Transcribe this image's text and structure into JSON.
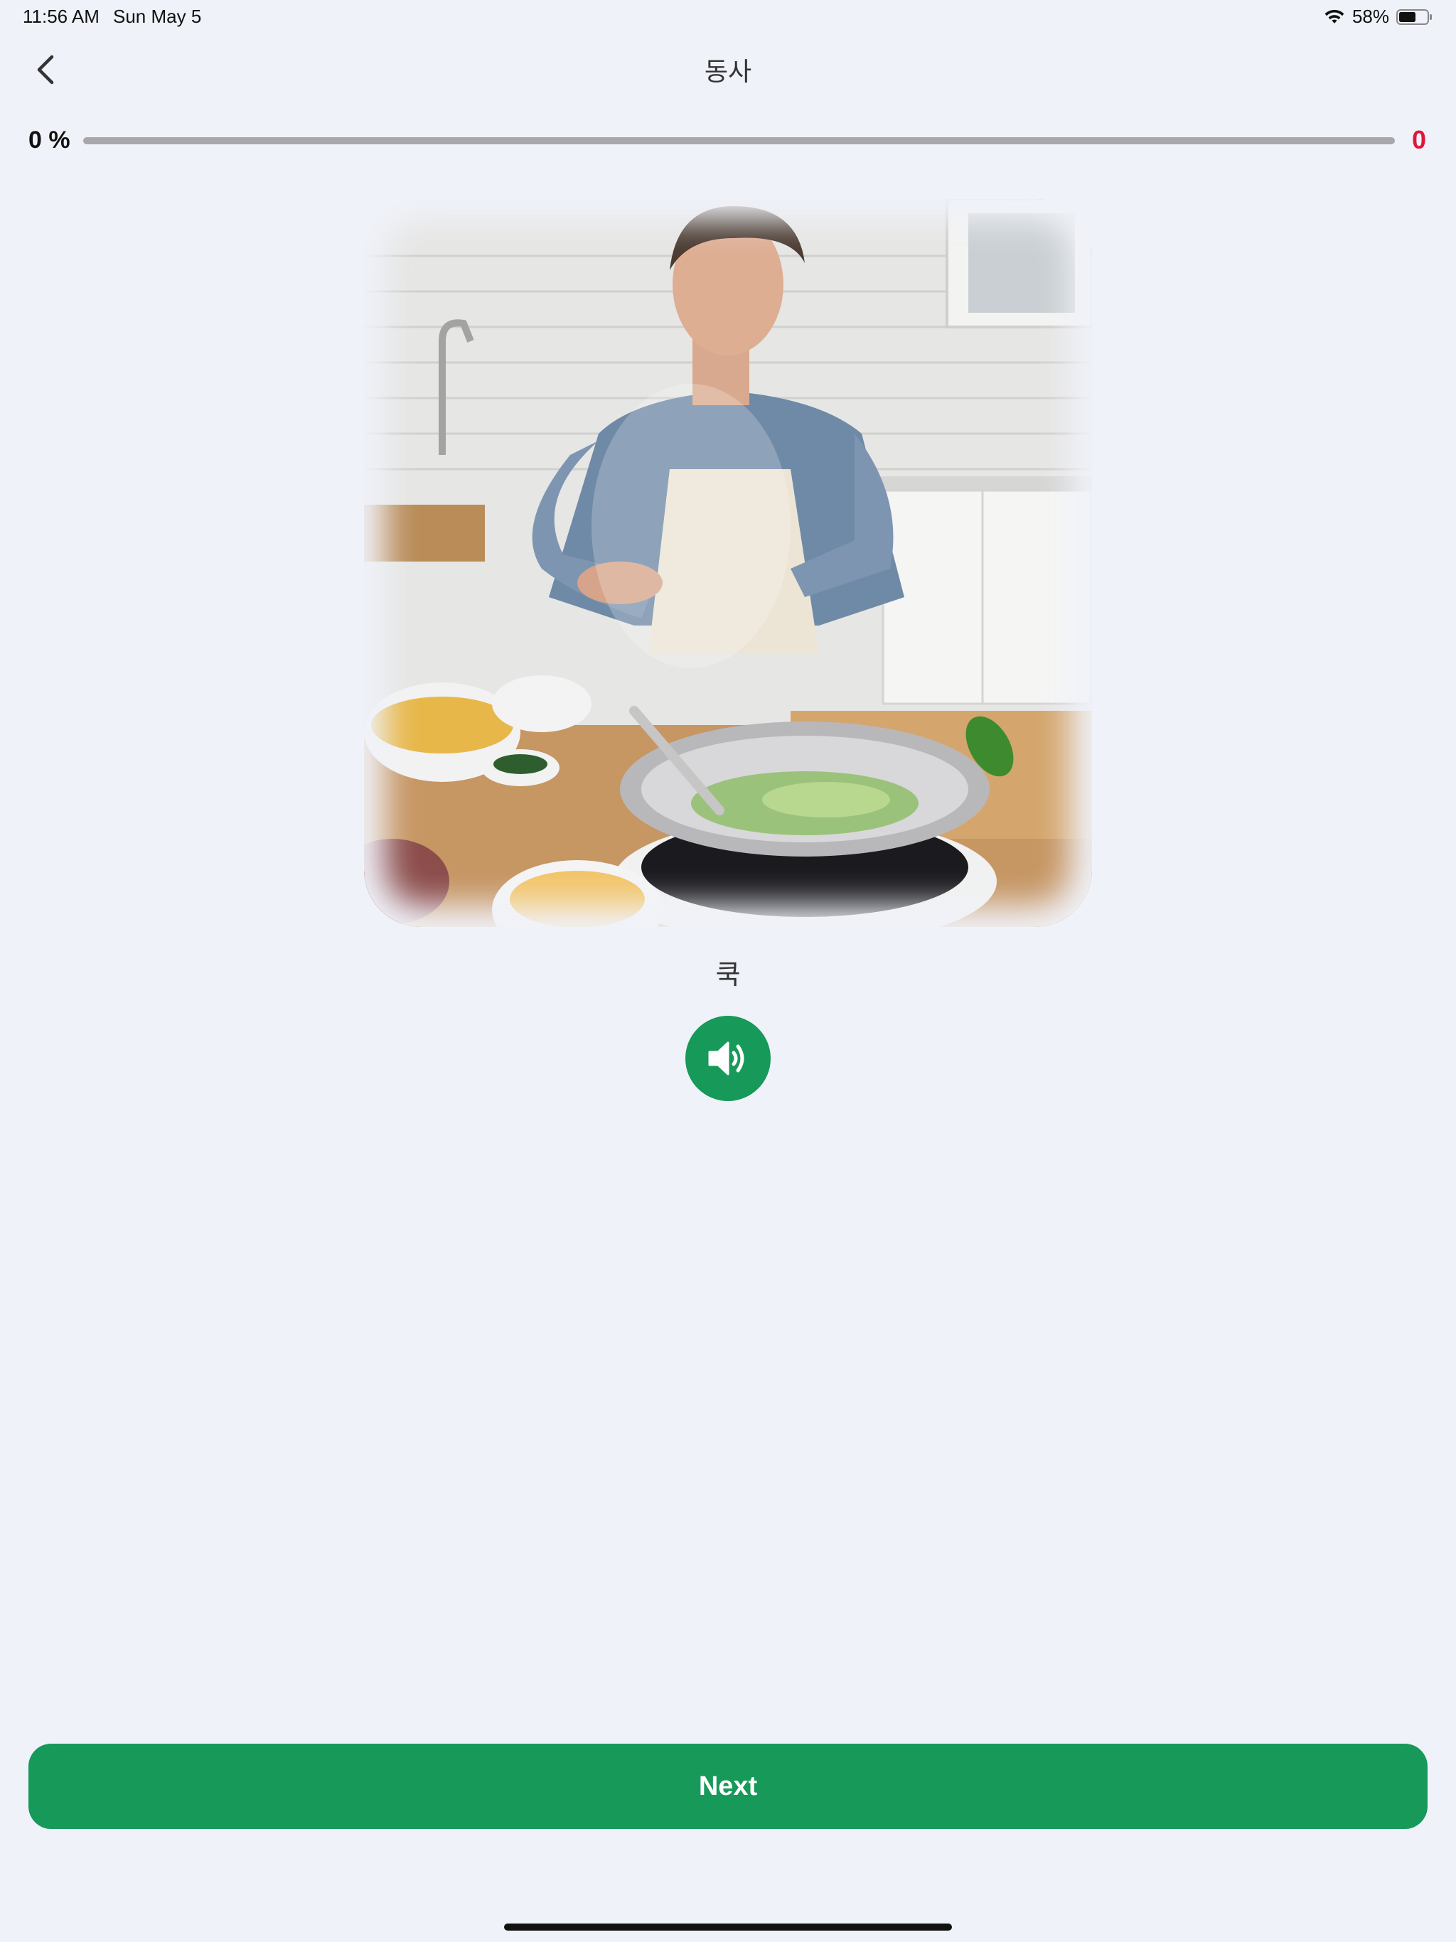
{
  "status_bar": {
    "time": "11:56 AM",
    "date": "Sun May 5",
    "battery": "58%",
    "wifi_icon": "wifi-icon",
    "battery_icon": "battery-icon"
  },
  "header": {
    "title": "동사",
    "back_icon": "chevron-left-icon"
  },
  "progress": {
    "label": "0 %",
    "fraction": 0,
    "score": "0"
  },
  "lesson": {
    "image_subject": "woman cooking vegetables in a wok in a kitchen",
    "word": "쿡",
    "audio_icon": "speaker-icon"
  },
  "footer": {
    "next_label": "Next"
  },
  "colors": {
    "background": "#f0f2f9",
    "accent": "#169959",
    "score": "#e0163a",
    "track": "#a7a7ac"
  }
}
